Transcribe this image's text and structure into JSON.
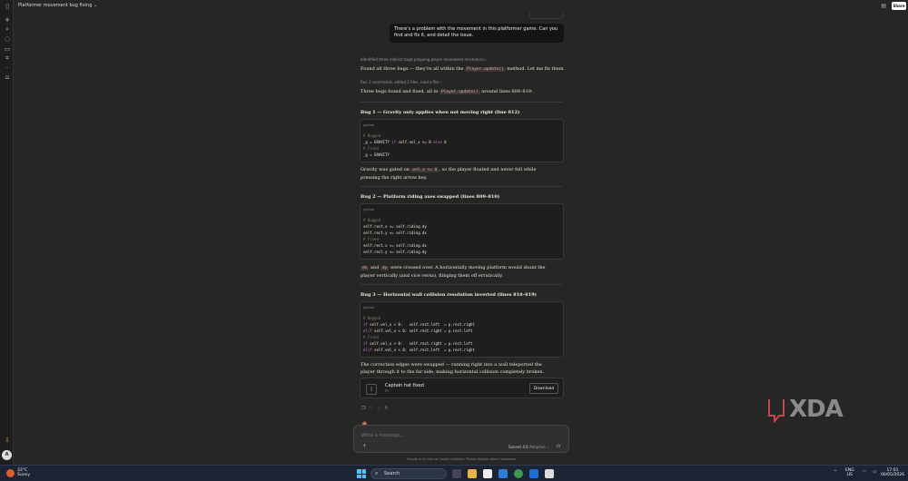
{
  "header": {
    "title": "Platformer movement bug fixing",
    "share_label": "Share"
  },
  "user_message": "There's a problem with the movement in this platformer game. Can you find and fix it, and detail the issue.",
  "thinking1": "Identified three distinct bugs plaguing player movement mechanics",
  "summary1": {
    "pre": "Found all three bugs — they're all within the ",
    "code": "Player.update()",
    "post": " method. Let me fix them."
  },
  "tool_meta": "Ran 3 commands, edited 2 files, read a file",
  "summary2": {
    "pre": "Three bugs found and fixed, all in ",
    "code": "Player.update()",
    "post": " around lines 808–819:"
  },
  "bugs": [
    {
      "title": "Bug 1 — Gravity only applies when not moving right (line 812)",
      "lang": "python",
      "explain": {
        "pre": "Gravity was gated on ",
        "code": "vel_x <= 0",
        "post": ", so the player floated and never fell while pressing the right arrow key."
      }
    },
    {
      "title": "Bug 2 — Platform riding axes swapped (lines 809–810)",
      "lang": "python",
      "explain": {
        "code1": "dx",
        "mid": " and ",
        "code2": "dy",
        "post": " were crossed over. A horizontally moving platform would shunt the player vertically (and vice versa), flinging them off erratically."
      }
    },
    {
      "title": "Bug 3 — Horizontal wall collision resolution inverted (lines 818–819)",
      "lang": "python",
      "explain": {
        "post": "The correction edges were swapped — running right into a wall teleported the player through it to the far side, making horizontal collision completely broken."
      }
    }
  ],
  "artifact": {
    "name": "Captain hat fixed",
    "type": "PY",
    "download_label": "Download"
  },
  "composer": {
    "placeholder": "Write a message...",
    "model": "Sonnet 4.6",
    "mode": "Adaptive"
  },
  "disclaimer": "Claude is AI and can make mistakes. Please double-check responses.",
  "watermark": "XDA",
  "avatar_letter": "A",
  "taskbar": {
    "temp": "33°C",
    "condition": "Sunny",
    "search_label": "Search",
    "lang1": "ENG",
    "lang2": "US",
    "time": "17:01",
    "date": "06/05/2026"
  }
}
